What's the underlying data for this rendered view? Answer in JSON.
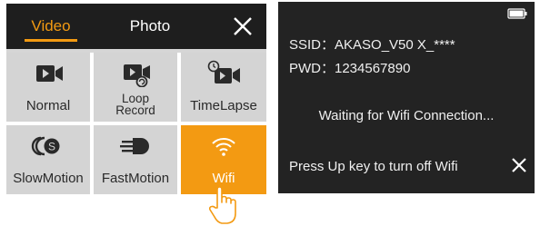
{
  "menu": {
    "tabs": [
      {
        "label": "Video",
        "active": true
      },
      {
        "label": "Photo",
        "active": false
      }
    ],
    "close_icon": "close-icon",
    "modes": [
      {
        "label": "Normal",
        "icon": "video-camera-icon",
        "selected": false
      },
      {
        "label": "Loop Record",
        "icon": "loop-record-icon",
        "selected": false
      },
      {
        "label": "TimeLapse",
        "icon": "timelapse-icon",
        "selected": false
      },
      {
        "label": "SlowMotion",
        "icon": "slow-motion-icon",
        "selected": false
      },
      {
        "label": "FastMotion",
        "icon": "fast-motion-icon",
        "selected": false
      },
      {
        "label": "Wifi",
        "icon": "wifi-icon",
        "selected": true
      }
    ]
  },
  "wifi_screen": {
    "ssid_line": "SSID：AKASO_V50 X_****",
    "pwd_line": "PWD：1234567890",
    "waiting": "Waiting for Wifi Connection...",
    "turn_off_hint": "Press Up key to turn off Wifi",
    "battery_icon": "battery-icon",
    "close_icon": "close-icon"
  },
  "colors": {
    "accent": "#f39a12",
    "header_bg": "#1e1e1e",
    "tile_bg": "#d4d4d4",
    "screen_bg": "#232323"
  }
}
